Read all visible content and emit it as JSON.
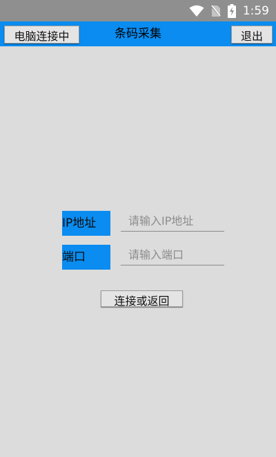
{
  "status_bar": {
    "time": "1:59",
    "icons": [
      "wifi-icon",
      "no-sim-icon",
      "battery-charging-icon"
    ],
    "color": "#8f8f8f"
  },
  "app_bar": {
    "title": "条码采集",
    "left_button": "电脑连接中",
    "right_button": "退出",
    "color": "#0a8cf0"
  },
  "form": {
    "ip_label": "IP地址",
    "ip_placeholder": "请输入IP地址",
    "ip_value": "",
    "port_label": "端口",
    "port_placeholder": "请输入端口",
    "port_value": "",
    "connect_button": "连接或返回"
  },
  "colors": {
    "background": "#dcdcdc",
    "accent": "#0a8cf0",
    "button": "#e4e4e4"
  }
}
